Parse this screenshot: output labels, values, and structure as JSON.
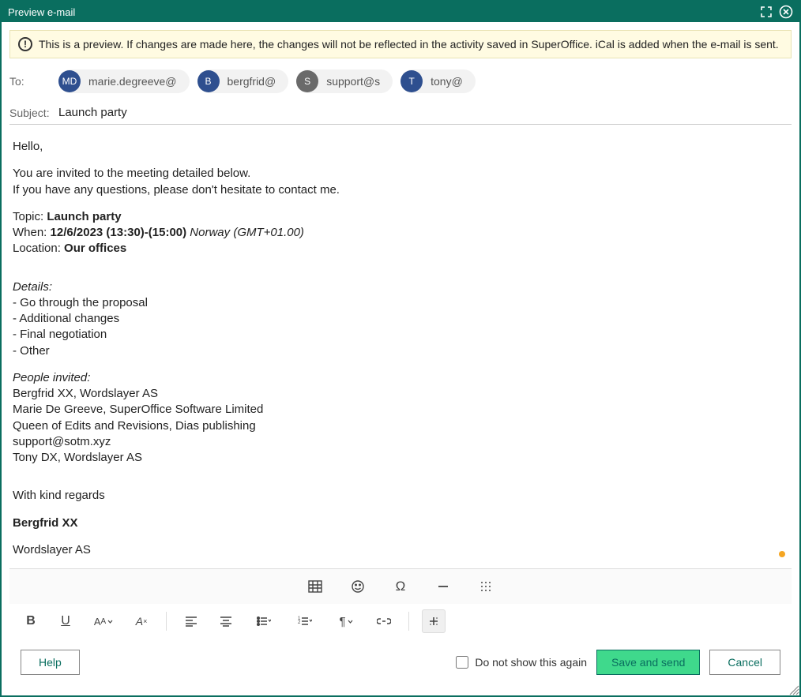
{
  "dialog": {
    "title": "Preview e-mail"
  },
  "warning": {
    "text": "This is a preview. If changes are made here, the changes will not be reflected in the activity saved in SuperOffice. iCal is added when the e-mail is sent."
  },
  "fields": {
    "to_label": "To:",
    "subject_label": "Subject:",
    "subject_value": "Launch party"
  },
  "recipients": [
    {
      "initials": "MD",
      "address": "marie.degreeve@",
      "color": "#2e4f8f"
    },
    {
      "initials": "B",
      "address": "bergfrid@",
      "color": "#2e4f8f"
    },
    {
      "initials": "S",
      "address": "support@s",
      "color": "#6a6a6a"
    },
    {
      "initials": "T",
      "address": "tony@",
      "color": "#2e4f8f"
    }
  ],
  "body": {
    "greeting": "Hello,",
    "intro1": "You are invited to the meeting detailed below.",
    "intro2": "If you have any questions, please don't hesitate to contact me.",
    "topic_label": "Topic: ",
    "topic_value": "Launch party",
    "when_label": "When: ",
    "when_value": "12/6/2023 (13:30)-(15:00)",
    "when_tz": " Norway (GMT+01.00)",
    "location_label": "Location: ",
    "location_value": "Our offices",
    "details_label": "Details:",
    "details": [
      "- Go through the proposal",
      "- Additional changes",
      "- Final negotiation",
      "- Other"
    ],
    "invited_label": "People invited:",
    "invited": [
      "Bergfrid XX, Wordslayer AS",
      "Marie De Greeve, SuperOffice Software Limited",
      "Queen of Edits and Revisions, Dias publishing",
      "support@sotm.xyz",
      "Tony DX, Wordslayer AS"
    ],
    "signoff": "With kind regards",
    "sender_name": "Bergfrid XX",
    "sender_company": "Wordslayer AS"
  },
  "footer": {
    "help": "Help",
    "dont_show": "Do not show this again",
    "save_send": "Save and send",
    "cancel": "Cancel"
  }
}
